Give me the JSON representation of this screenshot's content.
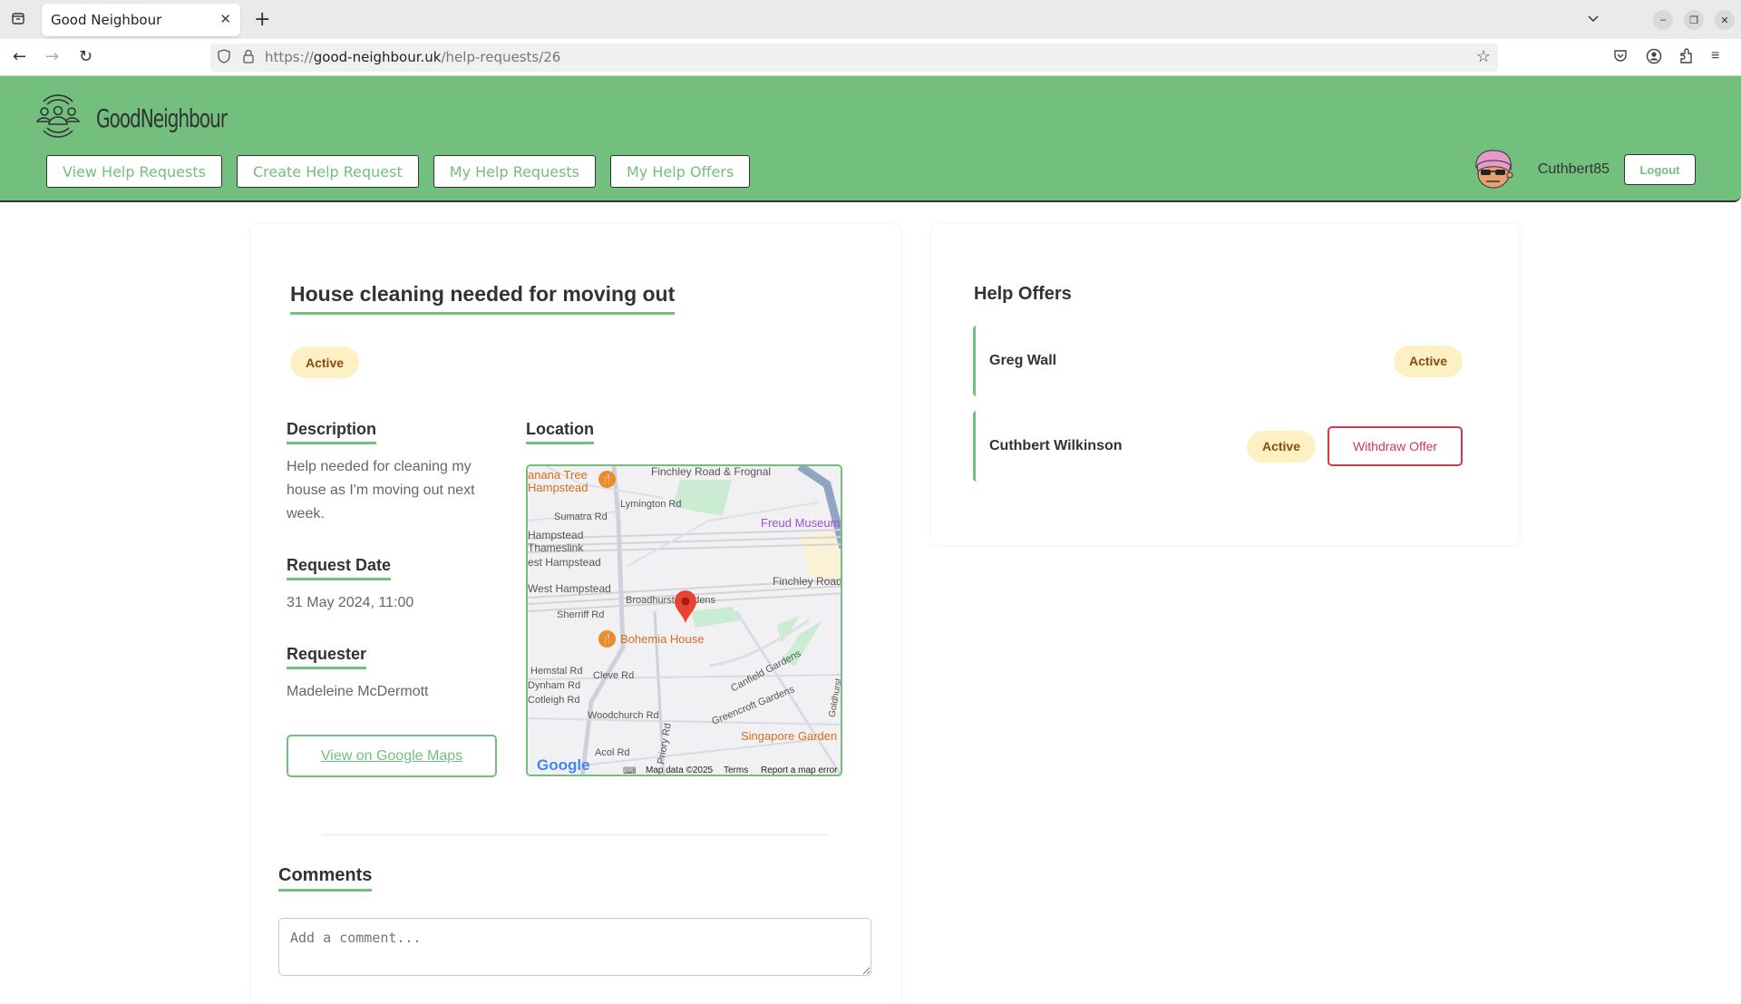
{
  "browser": {
    "tab_title": "Good Neighbour",
    "url_prefix": "https://",
    "url_domain": "good-neighbour.uk",
    "url_path": "/help-requests/26"
  },
  "header": {
    "logo_text": "GoodNeighbour",
    "nav": [
      {
        "label": "View Help Requests"
      },
      {
        "label": "Create Help Request"
      },
      {
        "label": "My Help Requests"
      },
      {
        "label": "My Help Offers"
      }
    ],
    "username": "Cuthbert85",
    "logout_label": "Logout"
  },
  "request": {
    "title": "House cleaning needed for moving out",
    "status": "Active",
    "description_heading": "Description",
    "description": "Help needed for cleaning my house as I'm moving out next week.",
    "date_heading": "Request Date",
    "date": "31 May 2024, 11:00",
    "requester_heading": "Requester",
    "requester": "Madeleine McDermott",
    "maps_button": "View on Google Maps",
    "location_heading": "Location"
  },
  "map": {
    "labels": {
      "banana_tree": "anana Tree",
      "banana_tree2": "Hampstead",
      "finchley_frognal": "Finchley Road & Frognal",
      "lymington": "Lymington Rd",
      "sumatra": "Sumatra Rd",
      "freud": "Freud Museum",
      "hampstead_thameslink": "Hampstead",
      "hampstead_thameslink2": "Thameslink",
      "est_hampstead": "est Hampstead",
      "west_hampstead": "West Hampstead",
      "finchley_road": "Finchley Road",
      "broadhurst": "Broadhurst Gardens",
      "sherriff": "Sherriff Rd",
      "bohemia": "Bohemia House",
      "hemstal": "Hemstal Rd",
      "dynham": "Dynham Rd",
      "cotleigh": "Cotleigh Rd",
      "cleve": "Cleve Rd",
      "canfield": "Canfield Gardens",
      "woodchurch": "Woodchurch Rd",
      "greencroft": "Greencroft Gardens",
      "singapore": "Singapore Garden",
      "priory": "Priory Rd",
      "acol": "Acol Rd",
      "goldhurst": "Goldhurst",
      "google": "Google",
      "map_data": "Map data ©2025",
      "terms": "Terms",
      "report": "Report a map error"
    }
  },
  "comments": {
    "heading": "Comments",
    "placeholder": "Add a comment..."
  },
  "offers": {
    "heading": "Help Offers",
    "items": [
      {
        "name": "Greg Wall",
        "status": "Active"
      },
      {
        "name": "Cuthbert Wilkinson",
        "status": "Active",
        "action": "Withdraw Offer"
      }
    ]
  },
  "colors": {
    "brand_green": "#72bf7e",
    "badge_bg": "#fdf0c2",
    "badge_text": "#8a4a10",
    "danger": "#d6384a"
  }
}
